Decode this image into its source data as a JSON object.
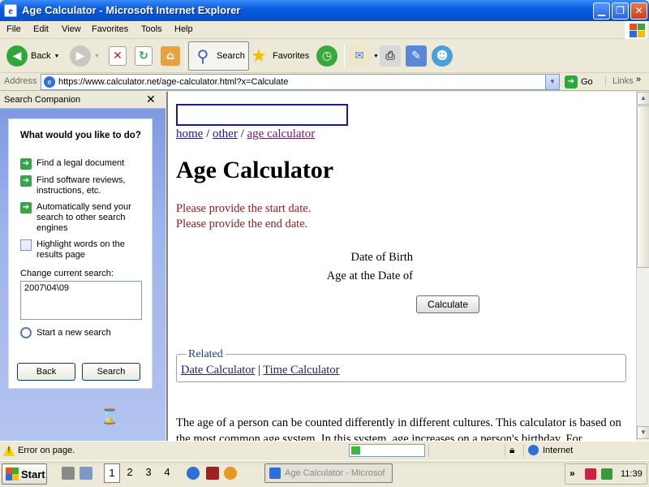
{
  "window": {
    "title": "Age Calculator - Microsoft Internet Explorer",
    "app_icon_glyph": "e"
  },
  "menu": [
    "File",
    "Edit",
    "View",
    "Favorites",
    "Tools",
    "Help"
  ],
  "toolbar": {
    "back_label": "Back",
    "search_label": "Search",
    "favorites_label": "Favorites"
  },
  "addressbar": {
    "label": "Address",
    "url": "https://www.calculator.net/age-calculator.html?x=Calculate",
    "go_label": "Go",
    "links_label": "Links",
    "links_chevron": "»"
  },
  "search_companion": {
    "title": "Search Companion",
    "close_glyph": "✕",
    "question": "What would you like to do?",
    "options": [
      "Find a legal document",
      "Find software reviews, instructions, etc.",
      "Automatically send your search to other search engines",
      "Highlight words on the results page"
    ],
    "change_label": "Change current search:",
    "current_search": "2007\\04\\09",
    "new_search_label": "Start a new search",
    "back_button": "Back",
    "search_button": "Search"
  },
  "page": {
    "breadcrumb": {
      "home": "home",
      "sep1": " / ",
      "other": "other",
      "sep2": " / ",
      "current": "age calculator"
    },
    "title": "Age Calculator",
    "errors": [
      "Please provide the start date.",
      "Please provide the end date."
    ],
    "date_of_birth_label": "Date of Birth",
    "age_at_label": "Age at the Date of",
    "calculate_button": "Calculate",
    "related_legend": "Related",
    "related_links": [
      "Date Calculator",
      "Time Calculator"
    ],
    "related_sep": " | ",
    "body_text": "The age of a person can be counted differently in different cultures. This calculator is based on the most common age system. In this system, age increases on a person's birthday. For"
  },
  "statusbar": {
    "message": "Error on page.",
    "zone": "Internet",
    "progress": 0.12
  },
  "taskbar": {
    "start_label": "Start",
    "virtual_desktops": [
      "1",
      "2",
      "3",
      "4"
    ],
    "active_desktop": "1",
    "task_label": "Age Calculator - Microsof",
    "tray_chevron": "»",
    "clock": "11:39"
  },
  "colors": {
    "titlebar_blue": "#0454d8",
    "error_red": "#a01818",
    "link_blue": "#1a1a8c",
    "visited_link": "#681a68",
    "pane_blue": "#9eb4ec"
  }
}
